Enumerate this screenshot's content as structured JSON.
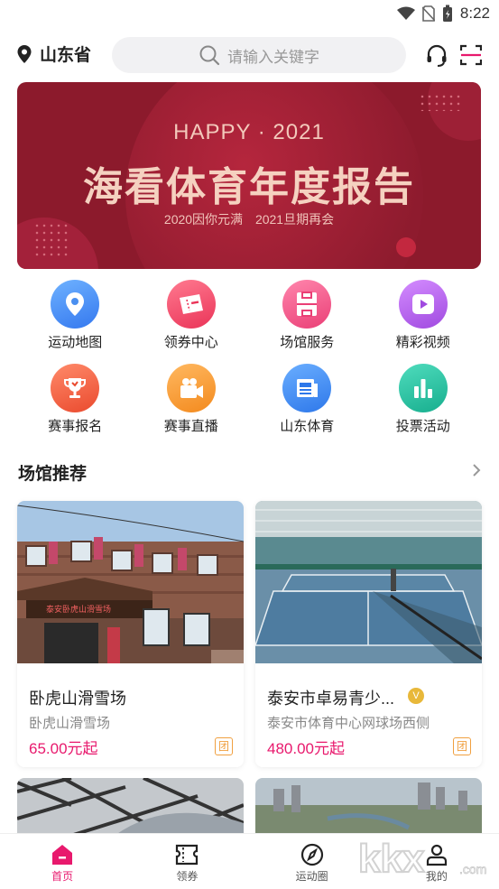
{
  "status_bar": {
    "time": "8:22"
  },
  "header": {
    "location": "山东省",
    "search_placeholder": "请输入关键字"
  },
  "banner": {
    "happy": "HAPPY · 2021",
    "title": "海看体育年度报告",
    "subtitle": "2020因你元满  2021旦期再会"
  },
  "grid": [
    {
      "label": "运动地图",
      "icon": "map-pin-icon",
      "color": "#4a8ff0"
    },
    {
      "label": "领券中心",
      "icon": "ticket-icon",
      "color": "#f2506f"
    },
    {
      "label": "场馆服务",
      "icon": "court-icon",
      "color": "#f05a88"
    },
    {
      "label": "精彩视频",
      "icon": "video-play-icon",
      "color": "#b75ae8"
    },
    {
      "label": "赛事报名",
      "icon": "trophy-icon",
      "color": "#f06440"
    },
    {
      "label": "赛事直播",
      "icon": "camera-icon",
      "color": "#f39a2e"
    },
    {
      "label": "山东体育",
      "icon": "news-icon",
      "color": "#3c8ff0"
    },
    {
      "label": "投票活动",
      "icon": "bar-chart-icon",
      "color": "#22c0a0"
    }
  ],
  "section": {
    "title": "场馆推荐"
  },
  "venues": [
    {
      "name": "卧虎山滑雪场",
      "address": "卧虎山滑雪场",
      "price": "65.00元起",
      "tag": "团",
      "sign_text": "泰安卧虎山滑雪场"
    },
    {
      "name": "泰安市卓易青少...",
      "address": "泰安市体育中心网球场西侧",
      "price": "480.00元起",
      "tag": "团",
      "badge": "V"
    }
  ],
  "tabbar": [
    {
      "label": "首页",
      "active": true
    },
    {
      "label": "领券",
      "active": false
    },
    {
      "label": "运动圈",
      "active": false
    },
    {
      "label": "我的",
      "active": false
    }
  ],
  "watermark": {
    "text": "kkx",
    "domain": ".com"
  }
}
